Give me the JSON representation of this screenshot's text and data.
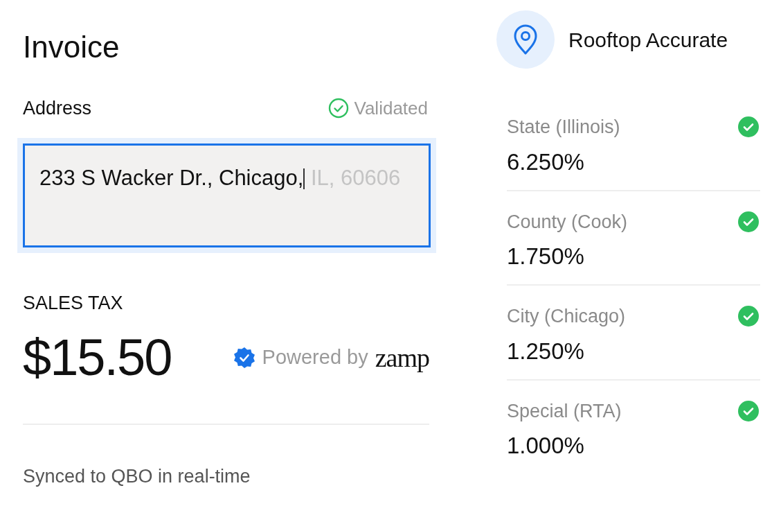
{
  "title": "Invoice",
  "address": {
    "label": "Address",
    "status": "Validated",
    "validated": true,
    "value": "233 S Wacker Dr., Chicago,",
    "suggestion": " IL, 60606",
    "focused": true
  },
  "sales_tax": {
    "label": "SALES TAX",
    "amount": "$15.50",
    "powered_by": "Powered by",
    "brand": "zamp"
  },
  "sync_note": "Synced to QBO in real-time",
  "accuracy": {
    "label": "Rooftop Accurate"
  },
  "rates": [
    {
      "name": "State (Illinois)",
      "rate": "6.250%",
      "validated": true
    },
    {
      "name": "County (Cook)",
      "rate": "1.750%",
      "validated": true
    },
    {
      "name": "City (Chicago)",
      "rate": "1.250%",
      "validated": true
    },
    {
      "name": "Special (RTA)",
      "rate": "1.000%",
      "validated": true
    }
  ]
}
